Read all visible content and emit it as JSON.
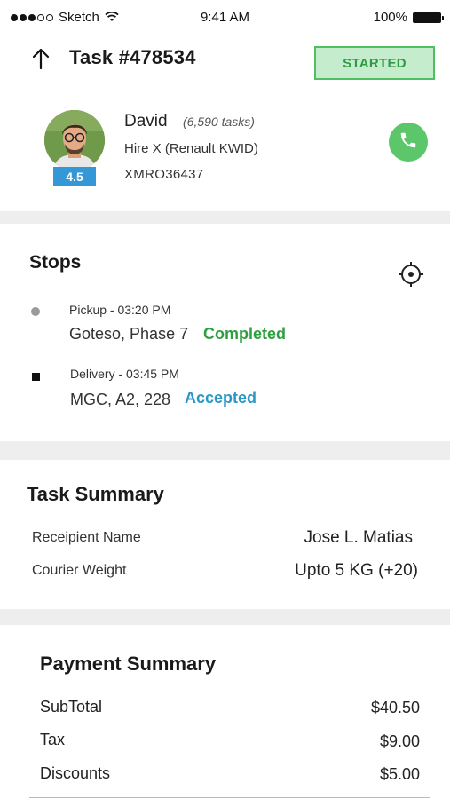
{
  "status_bar": {
    "carrier": "Sketch",
    "time": "9:41 AM",
    "battery": "100%"
  },
  "header": {
    "title": "Task #478534",
    "status": "STARTED"
  },
  "driver": {
    "name": "David",
    "tasks": "(6,590 tasks)",
    "vehicle": "Hire X (Renault KWID)",
    "plate": "XMRO36437",
    "rating": "4.5"
  },
  "stops": {
    "title": "Stops",
    "items": [
      {
        "meta": "Pickup - 03:20 PM",
        "place": "Goteso, Phase 7",
        "status": "Completed"
      },
      {
        "meta": "Delivery - 03:45 PM",
        "place": "MGC, A2, 228",
        "status": "Accepted"
      }
    ]
  },
  "task_summary": {
    "title": "Task Summary",
    "rows": [
      {
        "label": "Receipient Name",
        "value": "Jose L. Matias"
      },
      {
        "label": "Courier Weight",
        "value": "Upto 5 KG (+20)"
      }
    ]
  },
  "payment_summary": {
    "title": "Payment Summary",
    "rows": [
      {
        "label": "SubTotal",
        "value": "$40.50"
      },
      {
        "label": "Tax",
        "value": "$9.00"
      },
      {
        "label": "Discounts",
        "value": "$5.00"
      }
    ]
  },
  "colors": {
    "started_badge_bg": "#c6ecce",
    "started_badge_text": "#2f9a46",
    "completed": "#2fa042",
    "accepted": "#2a98c7",
    "rating_bg": "#3498d6",
    "call_button": "#5cc76a"
  },
  "icons": {
    "back": "arrow-up-icon",
    "call": "phone-icon",
    "locate": "crosshair-icon",
    "wifi": "wifi-icon",
    "battery": "battery-icon"
  }
}
